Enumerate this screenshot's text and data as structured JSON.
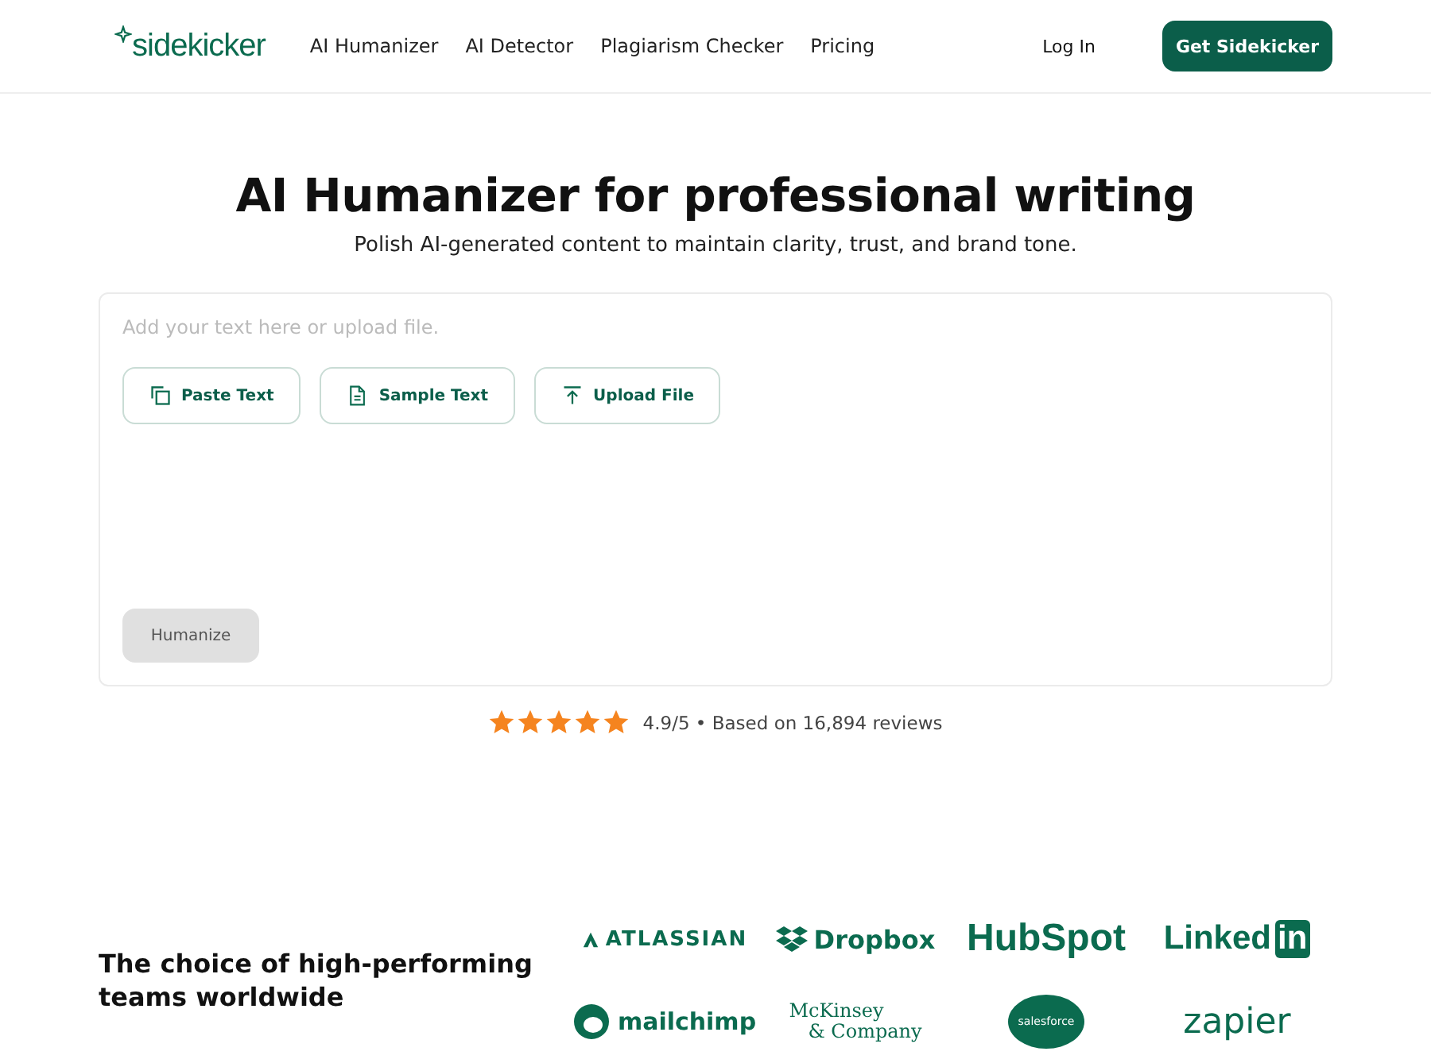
{
  "header": {
    "logo": "sidekicker",
    "nav": [
      {
        "label": "AI Humanizer"
      },
      {
        "label": "AI Detector"
      },
      {
        "label": "Plagiarism Checker"
      },
      {
        "label": "Pricing"
      }
    ],
    "login": "Log In",
    "cta": "Get Sidekicker"
  },
  "hero": {
    "title": "AI Humanizer for professional writing",
    "subtitle": "Polish AI-generated content to maintain clarity, trust, and brand tone."
  },
  "editor": {
    "placeholder": "Add your text here or upload file.",
    "actions": [
      {
        "kind": "paste",
        "label": "Paste Text"
      },
      {
        "kind": "sample",
        "label": "Sample Text"
      },
      {
        "kind": "upload",
        "label": "Upload File"
      }
    ],
    "submit": {
      "label": "Humanize",
      "disabled": true
    }
  },
  "rating": {
    "stars": 5,
    "text": "4.9/5 • Based on 16,894 reviews"
  },
  "customers": {
    "heading": "The choice of high-performing teams worldwide",
    "logos": [
      {
        "kind": "atlassian",
        "text": "ATLASSIAN"
      },
      {
        "kind": "dropbox",
        "text": "Dropbox"
      },
      {
        "kind": "hubspot",
        "text": "HubSpot"
      },
      {
        "kind": "linkedin",
        "text": "Linked",
        "badge": "in"
      },
      {
        "kind": "mailchimp",
        "text": "mailchimp"
      },
      {
        "kind": "mckinsey",
        "text": "McKinsey",
        "line2": "& Company"
      },
      {
        "kind": "salesforce",
        "text": "salesforce"
      },
      {
        "kind": "zapier",
        "text": "zapier"
      }
    ]
  }
}
